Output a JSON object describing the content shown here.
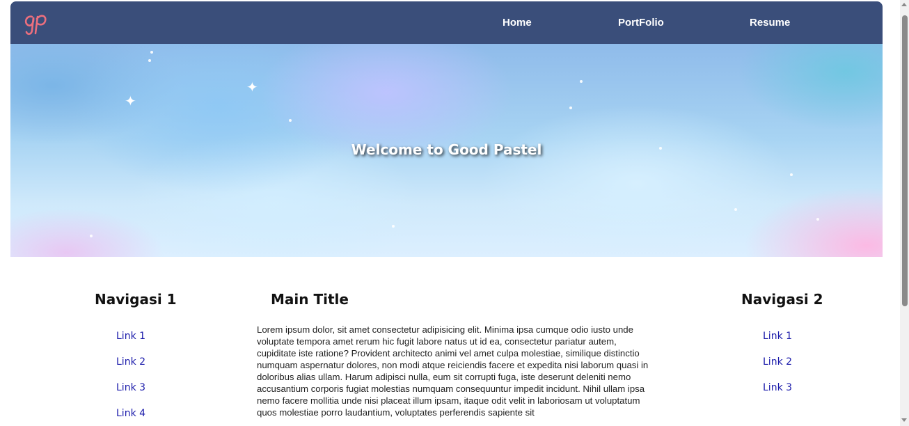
{
  "navbar": {
    "logo_text": "gp",
    "links": [
      {
        "label": "Home"
      },
      {
        "label": "PortFolio"
      },
      {
        "label": "Resume"
      }
    ]
  },
  "hero": {
    "title": "Welcome to Good Pastel"
  },
  "left_nav": {
    "title": "Navigasi 1",
    "links": [
      "Link 1",
      "Link 2",
      "Link 3",
      "Link 4"
    ]
  },
  "main": {
    "title": "Main Title",
    "body": "Lorem ipsum dolor, sit amet consectetur adipisicing elit. Minima ipsa cumque odio iusto unde voluptate tempora amet rerum hic fugit labore natus ut id ea, consectetur pariatur autem, cupiditate iste ratione? Provident architecto animi vel amet culpa molestiae, similique distinctio numquam aspernatur dolores, non modi atque reiciendis facere et expedita nisi laborum quasi in doloribus alias ullam. Harum adipisci nulla, eum sit corrupti fuga, iste deserunt deleniti nemo accusantium corporis fugiat molestias numquam consequuntur impedit incidunt. Nihil ullam ipsa nemo facere mollitia unde nisi placeat illum ipsam, itaque odit velit in laboriosam ut voluptatum quos molestiae porro laudantium, voluptates perferendis sapiente sit"
  },
  "right_nav": {
    "title": "Navigasi 2",
    "links": [
      "Link 1",
      "Link 2",
      "Link 3"
    ]
  },
  "colors": {
    "navbar_bg": "#3a4e7a",
    "logo": "#ec6f7e",
    "link": "#1a1aaa"
  }
}
